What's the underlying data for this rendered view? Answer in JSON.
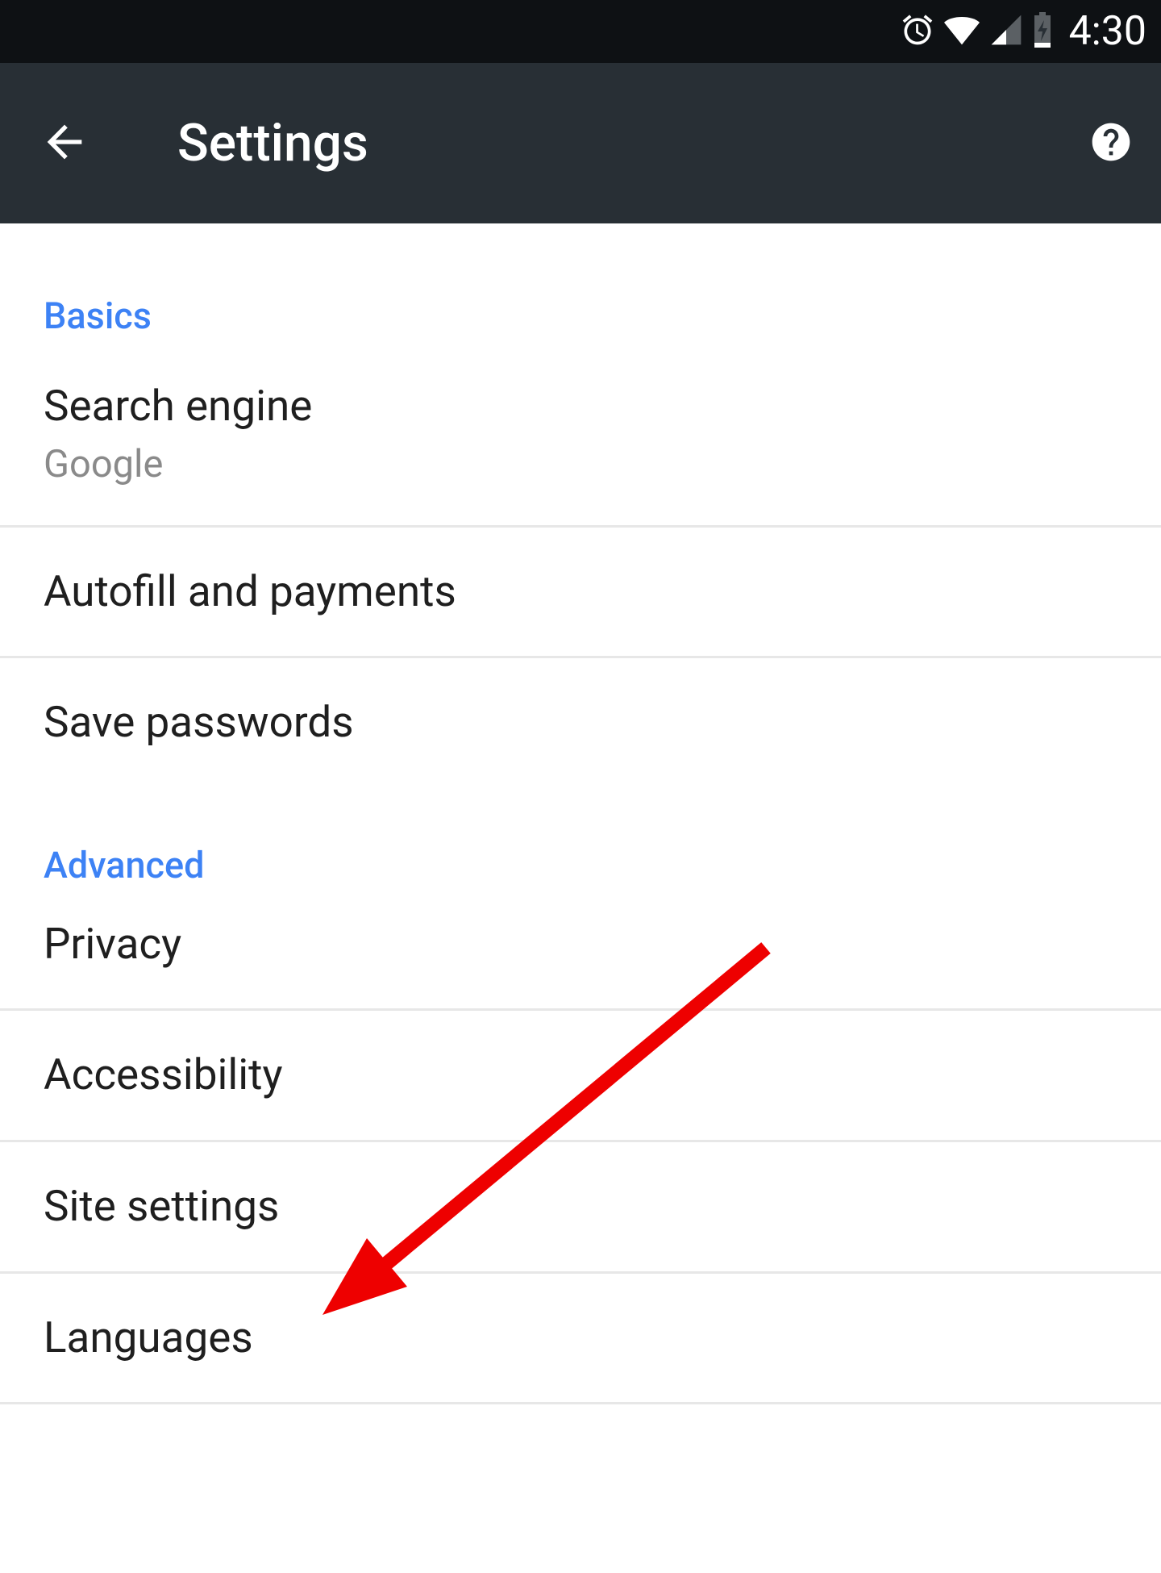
{
  "status_bar": {
    "time": "4:30"
  },
  "app_bar": {
    "title": "Settings"
  },
  "sections": {
    "basics": {
      "header": "Basics",
      "items": [
        {
          "title": "Search engine",
          "subtitle": "Google"
        },
        {
          "title": "Autofill and payments"
        },
        {
          "title": "Save passwords"
        }
      ]
    },
    "advanced": {
      "header": "Advanced",
      "items": [
        {
          "title": "Privacy"
        },
        {
          "title": "Accessibility"
        },
        {
          "title": "Site settings"
        },
        {
          "title": "Languages"
        }
      ]
    }
  }
}
